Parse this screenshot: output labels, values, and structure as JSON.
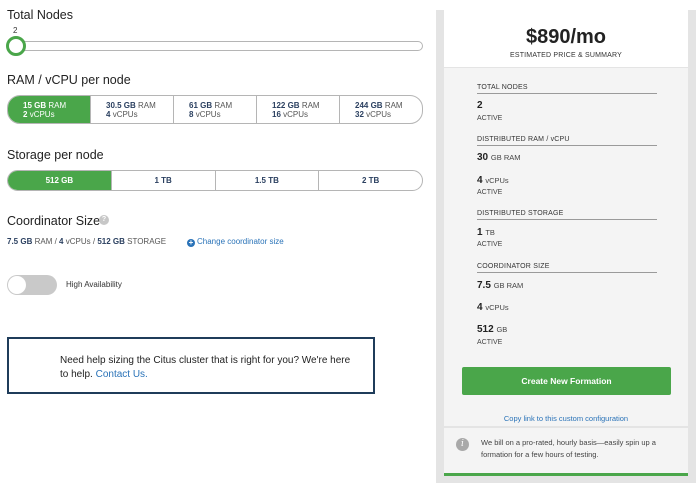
{
  "total_nodes": {
    "title": "Total Nodes",
    "value": "2"
  },
  "ram": {
    "title": "RAM / vCPU per node",
    "options": [
      {
        "ram_num": "15 GB",
        "ram_unit": "RAM",
        "cpu_num": "2",
        "cpu_unit": "vCPUs"
      },
      {
        "ram_num": "30.5 GB",
        "ram_unit": "RAM",
        "cpu_num": "4",
        "cpu_unit": "vCPUs"
      },
      {
        "ram_num": "61 GB",
        "ram_unit": "RAM",
        "cpu_num": "8",
        "cpu_unit": "vCPUs"
      },
      {
        "ram_num": "122 GB",
        "ram_unit": "RAM",
        "cpu_num": "16",
        "cpu_unit": "vCPUs"
      },
      {
        "ram_num": "244 GB",
        "ram_unit": "RAM",
        "cpu_num": "32",
        "cpu_unit": "vCPUs"
      }
    ],
    "selected": 0
  },
  "storage": {
    "title": "Storage per node",
    "options": [
      "512 GB",
      "1 TB",
      "1.5 TB",
      "2 TB"
    ],
    "selected": 0
  },
  "coordinator": {
    "title": "Coordinator Size",
    "ram": "7.5 GB",
    "ram_unit": "RAM /",
    "cpu": "4",
    "cpu_unit": "vCPUs /",
    "storage": "512 GB",
    "storage_unit": "STORAGE",
    "change_link": "Change coordinator size"
  },
  "ha": {
    "label": "High Availability",
    "enabled": false
  },
  "help": {
    "text": "Need help sizing the Citus cluster that is right for you? We're here to help.",
    "link": "Contact Us."
  },
  "summary": {
    "price": "$890/mo",
    "price_sub": "ESTIMATED PRICE & SUMMARY",
    "total_nodes_label": "TOTAL NODES",
    "total_nodes_value": "2",
    "total_nodes_status": "ACTIVE",
    "dist_ram_label": "DISTRIBUTED RAM / vCPU",
    "dist_ram_value": "30",
    "dist_ram_unit": "GB RAM",
    "dist_cpu_value": "4",
    "dist_cpu_unit": "vCPUs",
    "dist_ram_status": "ACTIVE",
    "dist_storage_label": "DISTRIBUTED STORAGE",
    "dist_storage_value": "1",
    "dist_storage_unit": "TB",
    "dist_storage_status": "ACTIVE",
    "coord_label": "COORDINATOR SIZE",
    "coord_ram_value": "7.5",
    "coord_ram_unit": "GB RAM",
    "coord_cpu_value": "4",
    "coord_cpu_unit": "vCPUs",
    "coord_storage_value": "512",
    "coord_storage_unit": "GB",
    "coord_status": "ACTIVE",
    "create_button": "Create New Formation",
    "copy_link": "Copy link to this custom configuration",
    "note": "We bill on a pro-rated, hourly basis—easily spin up a formation for a few hours of testing."
  },
  "colors": {
    "accent": "#4aa64a",
    "link": "#2a73b8",
    "navy": "#1f3c5a"
  },
  "icons": {
    "help": "question-icon",
    "change": "plus-circle-icon",
    "note": "info-icon"
  }
}
